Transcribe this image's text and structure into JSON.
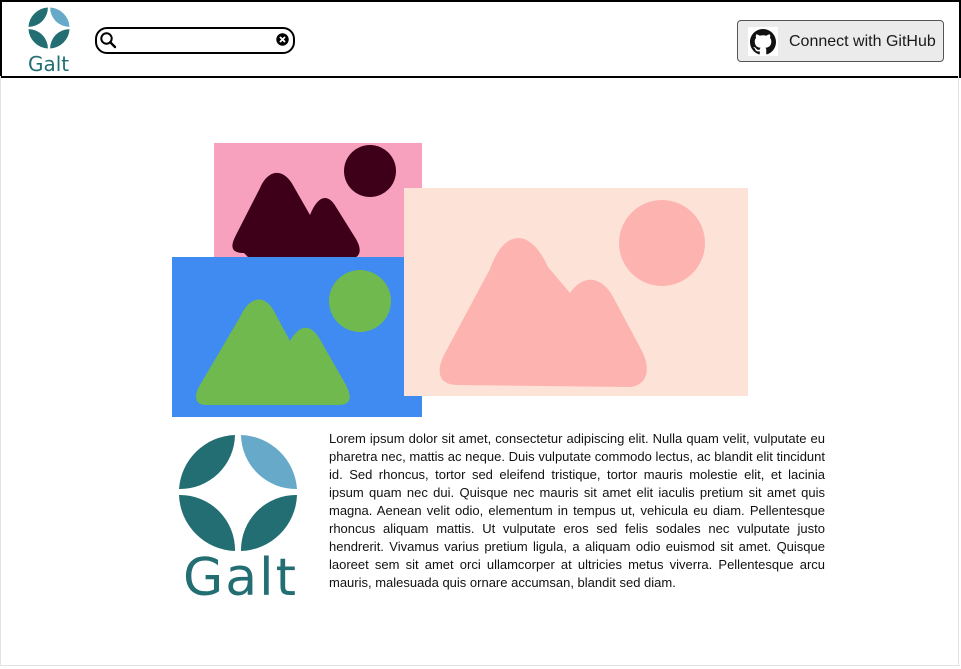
{
  "header": {
    "logo_text": "Galt",
    "search": {
      "value": "",
      "placeholder": ""
    },
    "github_button": {
      "label": "Connect with GitHub"
    }
  },
  "colors": {
    "brand_teal": "#236e73",
    "brand_light_blue": "#67a9c9",
    "image_pink": "#f7a1bf",
    "image_dark": "#3e0018",
    "image_blue": "#3f8bf2",
    "image_green": "#70b94f",
    "image_peach": "#fde2d8",
    "image_salmon": "#fdb4b0"
  },
  "main": {
    "logo_text": "Galt",
    "body_text": "Lorem ipsum dolor sit amet, consectetur adipiscing elit. Nulla quam velit, vulputate eu pharetra nec, mattis ac neque. Duis vulputate commodo lectus, ac blandit elit tincidunt id. Sed rhoncus, tortor sed eleifend tristique, tortor mauris molestie elit, et lacinia ipsum quam nec dui. Quisque nec mauris sit amet elit iaculis pretium sit amet quis magna. Aenean velit odio, elementum in tempus ut, vehicula eu diam. Pellentesque rhoncus aliquam mattis. Ut vulputate eros sed felis sodales nec vulputate justo hendrerit. Vivamus varius pretium ligula, a aliquam odio euismod sit amet. Quisque laoreet sem sit amet orci ullamcorper at ultricies metus viverra. Pellentesque arcu mauris, malesuada quis ornare accumsan, blandit sed diam."
  }
}
